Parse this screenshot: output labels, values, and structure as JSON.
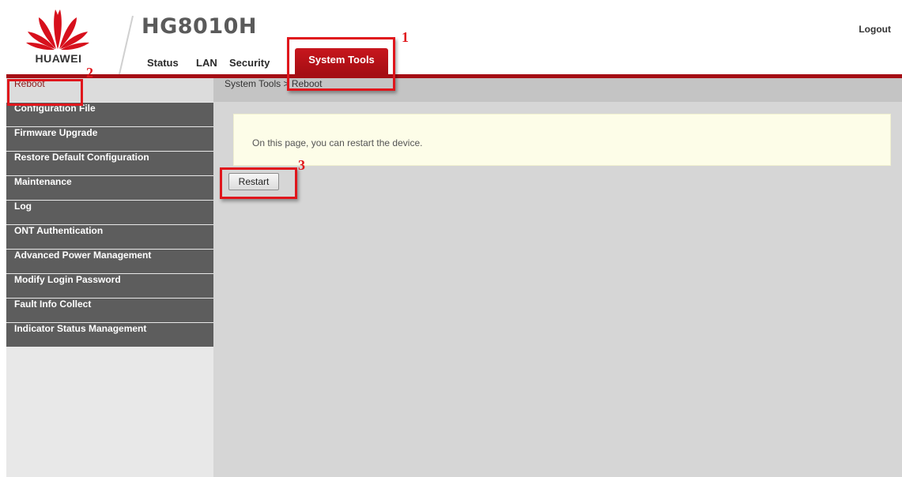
{
  "header": {
    "brand": "HUAWEI",
    "model": "HG8010H",
    "logout_label": "Logout",
    "nav_tabs": [
      {
        "label": "Status"
      },
      {
        "label": "LAN"
      },
      {
        "label": "Security"
      },
      {
        "label": "System Tools",
        "active": true
      }
    ]
  },
  "sidebar": {
    "items": [
      {
        "label": "Reboot",
        "active": true
      },
      {
        "label": "Configuration File"
      },
      {
        "label": "Firmware Upgrade"
      },
      {
        "label": "Restore Default Configuration"
      },
      {
        "label": "Maintenance"
      },
      {
        "label": "Log"
      },
      {
        "label": "ONT Authentication"
      },
      {
        "label": "Advanced Power Management"
      },
      {
        "label": "Modify Login Password"
      },
      {
        "label": "Fault Info Collect"
      },
      {
        "label": "Indicator Status Management"
      }
    ]
  },
  "main": {
    "breadcrumb": "System Tools > Reboot",
    "info_text": "On this page, you can restart the device.",
    "restart_label": "Restart"
  },
  "annotations": {
    "step1": "1",
    "step2": "2",
    "step3": "3"
  },
  "colors": {
    "brand_red": "#c8161d",
    "sidebar_item_bg": "#5d5d5d",
    "annotation_red": "#e0161c"
  }
}
